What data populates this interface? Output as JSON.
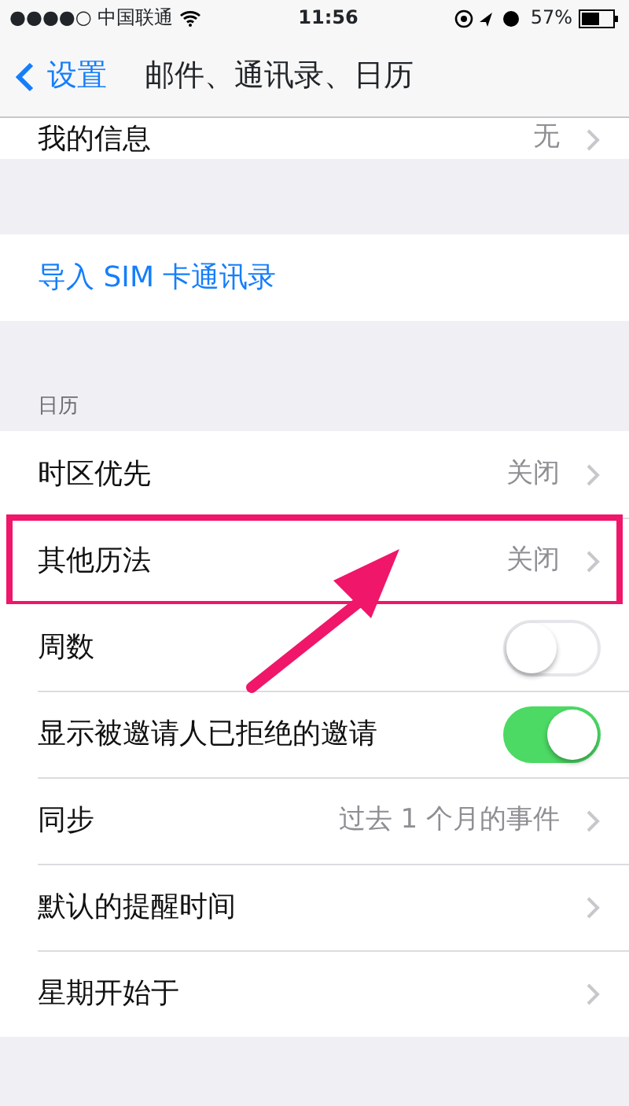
{
  "status_bar": {
    "carrier": "●●●●○ 中国联通",
    "time": "11:56",
    "battery": "57%"
  },
  "nav": {
    "back": "设置",
    "title": "邮件、通讯录、日历"
  },
  "sections": [
    {
      "rows": [
        {
          "kind": "disclosure",
          "label": "我的信息",
          "value": "无"
        }
      ]
    },
    {
      "rows": [
        {
          "kind": "link",
          "label": "导入 SIM 卡通讯录"
        }
      ]
    },
    {
      "header": "日历",
      "rows": [
        {
          "kind": "disclosure",
          "label": "时区优先",
          "value": "关闭"
        },
        {
          "kind": "disclosure",
          "label": "其他历法",
          "value": "关闭",
          "highlighted": true
        },
        {
          "kind": "toggle",
          "label": "周数",
          "on": false
        },
        {
          "kind": "toggle",
          "label": "显示被邀请人已拒绝的邀请",
          "on": true
        },
        {
          "kind": "disclosure",
          "label": "同步",
          "value": "过去 1 个月的事件"
        },
        {
          "kind": "disclosure",
          "label": "默认的提醒时间"
        },
        {
          "kind": "disclosure",
          "label": "星期开始于"
        }
      ]
    }
  ]
}
